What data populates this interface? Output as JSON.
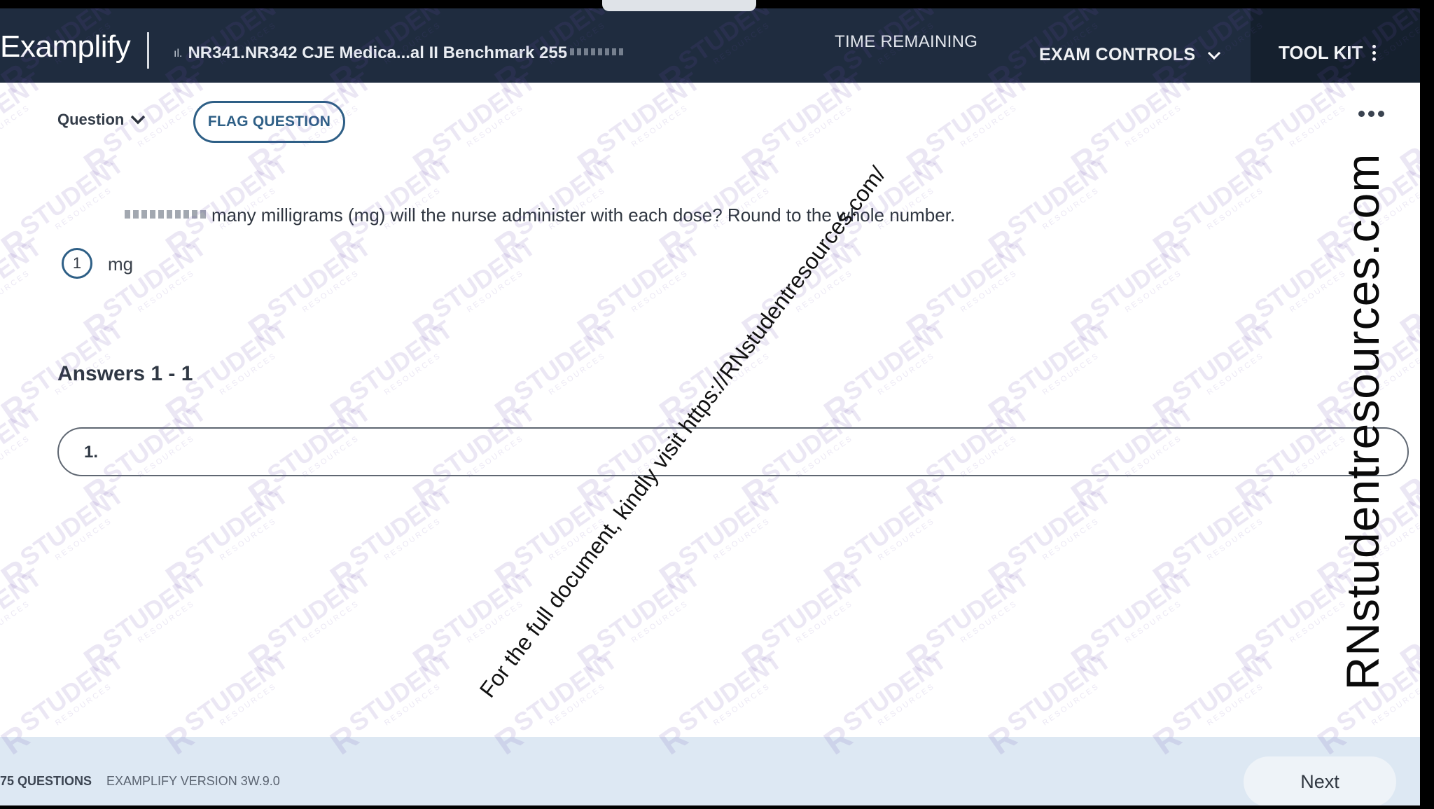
{
  "header": {
    "logo": "Examplify",
    "exam_title": "NR341.NR342 CJE Medica...al II Benchmark 255",
    "time_remaining_label": "TIME REMAINING",
    "exam_controls_label": "EXAM CONTROLS",
    "tool_kit_label": "TOOL KIT",
    "colors": {
      "header_bg": "#1f2c3f",
      "toolkit_bg": "#15202e"
    }
  },
  "question_bar": {
    "question_nav_label": "Question",
    "flag_button_label": "FLAG QUESTION"
  },
  "question": {
    "text": "many milligrams (mg) will the nurse administer with each dose? Round to the whole number.",
    "blank_number": "1",
    "blank_unit": "mg"
  },
  "answers": {
    "heading": "Answers 1 - 1",
    "items": [
      {
        "number": "1.",
        "value": ""
      }
    ]
  },
  "footer": {
    "question_count": "75 QUESTIONS",
    "version": "EXAMPLIFY VERSION 3W.9.0",
    "next_label": "Next",
    "colors": {
      "footer_bg": "#dde8f3",
      "accent": "#2e5f86"
    }
  },
  "watermarks": {
    "diagonal_text": "For the full document, kindly visit https://RNstudentresources.com/",
    "side_text": "RNstudentresources.com",
    "tile_text": "STUDENT",
    "tile_subtext": "RESOURCES"
  }
}
